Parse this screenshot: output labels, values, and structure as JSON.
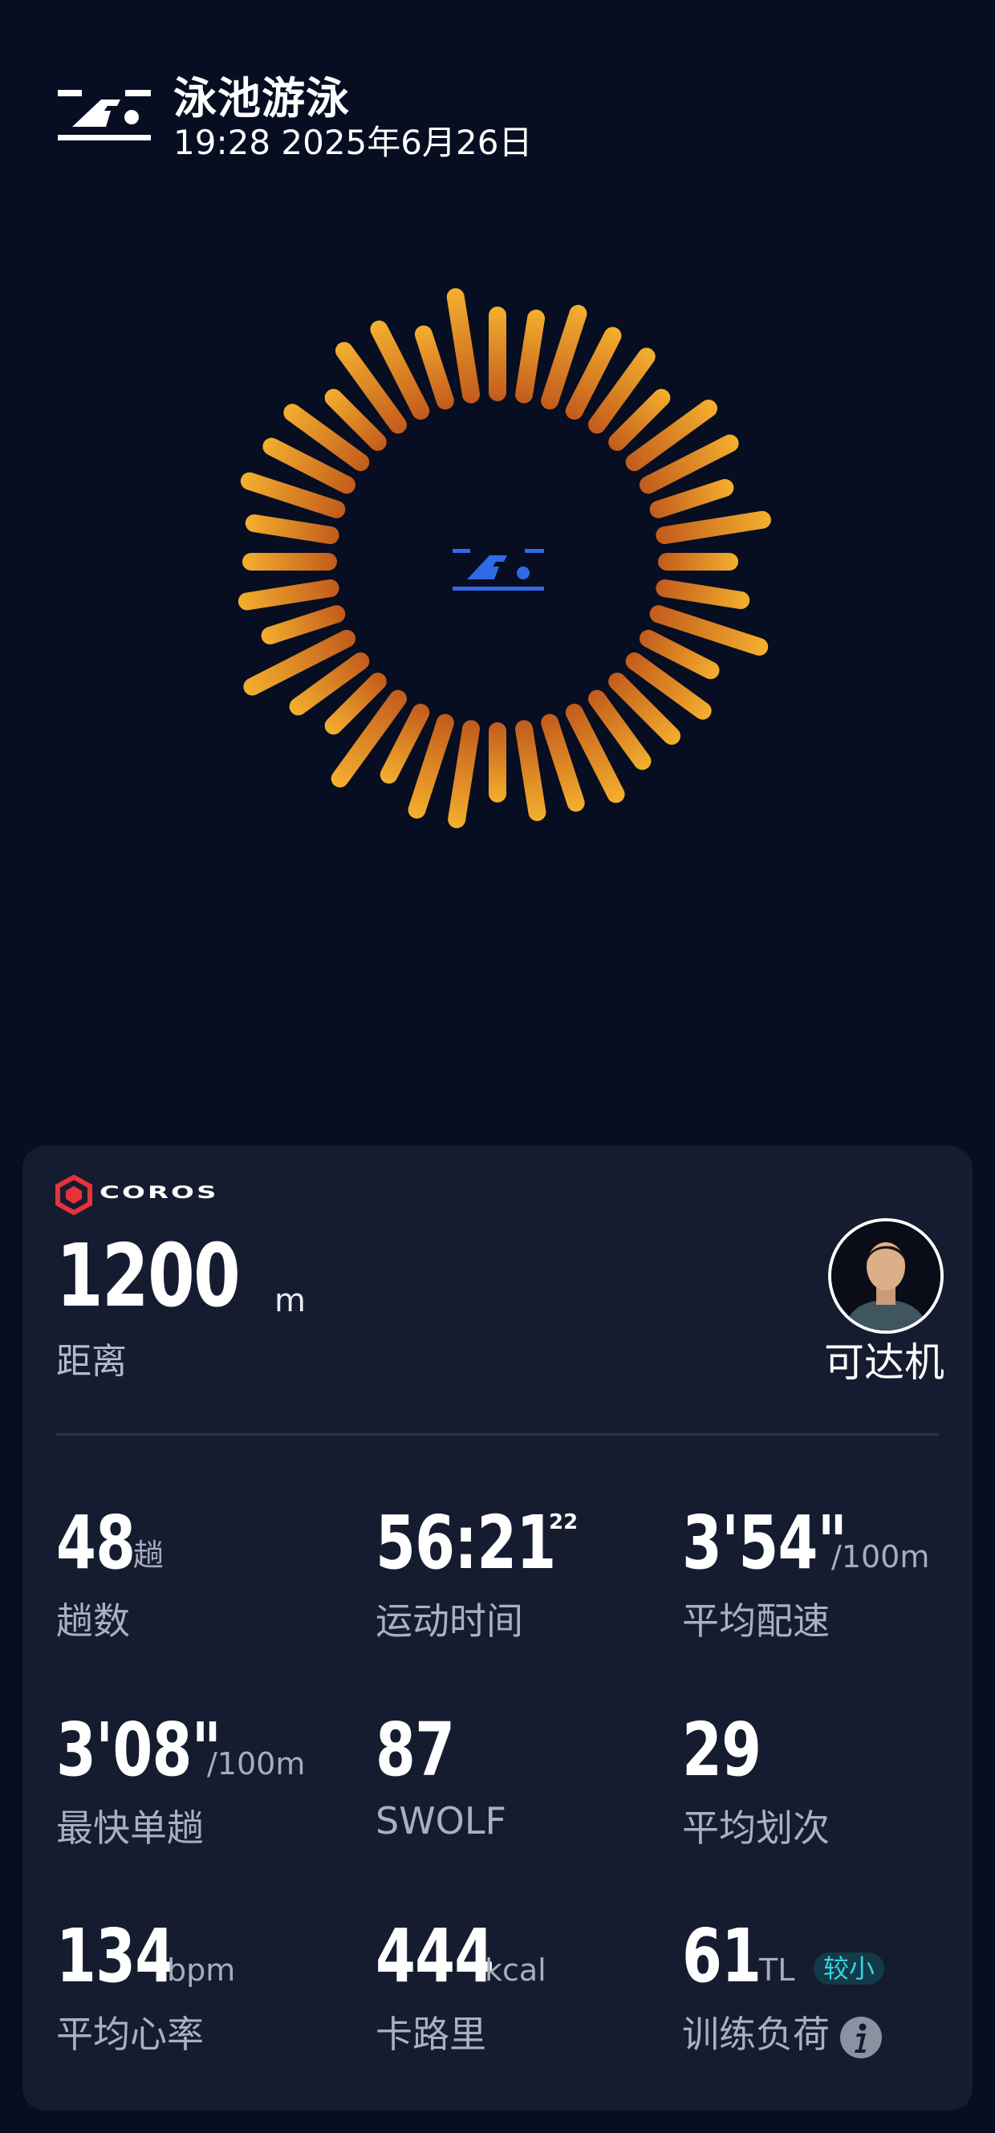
{
  "header": {
    "activity_icon": "pool-swim-icon",
    "title": "泳池游泳",
    "datetime": "19:28 2025年6月26日"
  },
  "hero": {
    "icon": "pool-swim-icon",
    "ring_colors": [
      "#f4b02e",
      "#c9601b"
    ]
  },
  "card": {
    "brand": "COROS",
    "brand_color": "#e8323a",
    "distance": {
      "value": "1200",
      "unit": "m",
      "label": "距离"
    },
    "user": {
      "name": "可达机",
      "avatar": "avatar-icon"
    },
    "stats": [
      {
        "value": "48",
        "unit": "趟",
        "label": "趟数"
      },
      {
        "value": "56:21",
        "sup": "22",
        "label": "运动时间"
      },
      {
        "value": "3'54\"",
        "unit": "/100m",
        "label": "平均配速"
      },
      {
        "value": "3'08\"",
        "unit": "/100m",
        "label": "最快单趟"
      },
      {
        "value": "87",
        "label": "SWOLF"
      },
      {
        "value": "29",
        "label": "平均划次"
      },
      {
        "value": "134",
        "unit": "bpm",
        "label": "平均心率"
      },
      {
        "value": "444",
        "unit": "kcal",
        "label": "卡路里"
      },
      {
        "value": "61",
        "unit": "TL",
        "badge": "较小",
        "label": "训练负荷",
        "info_icon": "info-icon"
      }
    ]
  }
}
